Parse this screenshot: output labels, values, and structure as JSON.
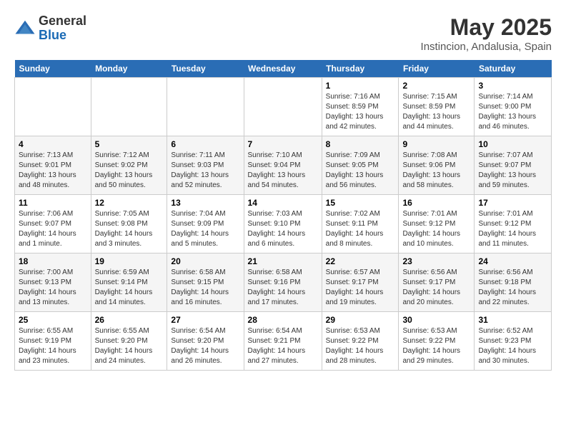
{
  "logo": {
    "general": "General",
    "blue": "Blue"
  },
  "title": "May 2025",
  "location": "Instincion, Andalusia, Spain",
  "days_of_week": [
    "Sunday",
    "Monday",
    "Tuesday",
    "Wednesday",
    "Thursday",
    "Friday",
    "Saturday"
  ],
  "weeks": [
    [
      {
        "day": "",
        "sunrise": "",
        "sunset": "",
        "daylight": ""
      },
      {
        "day": "",
        "sunrise": "",
        "sunset": "",
        "daylight": ""
      },
      {
        "day": "",
        "sunrise": "",
        "sunset": "",
        "daylight": ""
      },
      {
        "day": "",
        "sunrise": "",
        "sunset": "",
        "daylight": ""
      },
      {
        "day": "1",
        "sunrise": "Sunrise: 7:16 AM",
        "sunset": "Sunset: 8:59 PM",
        "daylight": "Daylight: 13 hours and 42 minutes."
      },
      {
        "day": "2",
        "sunrise": "Sunrise: 7:15 AM",
        "sunset": "Sunset: 8:59 PM",
        "daylight": "Daylight: 13 hours and 44 minutes."
      },
      {
        "day": "3",
        "sunrise": "Sunrise: 7:14 AM",
        "sunset": "Sunset: 9:00 PM",
        "daylight": "Daylight: 13 hours and 46 minutes."
      }
    ],
    [
      {
        "day": "4",
        "sunrise": "Sunrise: 7:13 AM",
        "sunset": "Sunset: 9:01 PM",
        "daylight": "Daylight: 13 hours and 48 minutes."
      },
      {
        "day": "5",
        "sunrise": "Sunrise: 7:12 AM",
        "sunset": "Sunset: 9:02 PM",
        "daylight": "Daylight: 13 hours and 50 minutes."
      },
      {
        "day": "6",
        "sunrise": "Sunrise: 7:11 AM",
        "sunset": "Sunset: 9:03 PM",
        "daylight": "Daylight: 13 hours and 52 minutes."
      },
      {
        "day": "7",
        "sunrise": "Sunrise: 7:10 AM",
        "sunset": "Sunset: 9:04 PM",
        "daylight": "Daylight: 13 hours and 54 minutes."
      },
      {
        "day": "8",
        "sunrise": "Sunrise: 7:09 AM",
        "sunset": "Sunset: 9:05 PM",
        "daylight": "Daylight: 13 hours and 56 minutes."
      },
      {
        "day": "9",
        "sunrise": "Sunrise: 7:08 AM",
        "sunset": "Sunset: 9:06 PM",
        "daylight": "Daylight: 13 hours and 58 minutes."
      },
      {
        "day": "10",
        "sunrise": "Sunrise: 7:07 AM",
        "sunset": "Sunset: 9:07 PM",
        "daylight": "Daylight: 13 hours and 59 minutes."
      }
    ],
    [
      {
        "day": "11",
        "sunrise": "Sunrise: 7:06 AM",
        "sunset": "Sunset: 9:07 PM",
        "daylight": "Daylight: 14 hours and 1 minute."
      },
      {
        "day": "12",
        "sunrise": "Sunrise: 7:05 AM",
        "sunset": "Sunset: 9:08 PM",
        "daylight": "Daylight: 14 hours and 3 minutes."
      },
      {
        "day": "13",
        "sunrise": "Sunrise: 7:04 AM",
        "sunset": "Sunset: 9:09 PM",
        "daylight": "Daylight: 14 hours and 5 minutes."
      },
      {
        "day": "14",
        "sunrise": "Sunrise: 7:03 AM",
        "sunset": "Sunset: 9:10 PM",
        "daylight": "Daylight: 14 hours and 6 minutes."
      },
      {
        "day": "15",
        "sunrise": "Sunrise: 7:02 AM",
        "sunset": "Sunset: 9:11 PM",
        "daylight": "Daylight: 14 hours and 8 minutes."
      },
      {
        "day": "16",
        "sunrise": "Sunrise: 7:01 AM",
        "sunset": "Sunset: 9:12 PM",
        "daylight": "Daylight: 14 hours and 10 minutes."
      },
      {
        "day": "17",
        "sunrise": "Sunrise: 7:01 AM",
        "sunset": "Sunset: 9:12 PM",
        "daylight": "Daylight: 14 hours and 11 minutes."
      }
    ],
    [
      {
        "day": "18",
        "sunrise": "Sunrise: 7:00 AM",
        "sunset": "Sunset: 9:13 PM",
        "daylight": "Daylight: 14 hours and 13 minutes."
      },
      {
        "day": "19",
        "sunrise": "Sunrise: 6:59 AM",
        "sunset": "Sunset: 9:14 PM",
        "daylight": "Daylight: 14 hours and 14 minutes."
      },
      {
        "day": "20",
        "sunrise": "Sunrise: 6:58 AM",
        "sunset": "Sunset: 9:15 PM",
        "daylight": "Daylight: 14 hours and 16 minutes."
      },
      {
        "day": "21",
        "sunrise": "Sunrise: 6:58 AM",
        "sunset": "Sunset: 9:16 PM",
        "daylight": "Daylight: 14 hours and 17 minutes."
      },
      {
        "day": "22",
        "sunrise": "Sunrise: 6:57 AM",
        "sunset": "Sunset: 9:17 PM",
        "daylight": "Daylight: 14 hours and 19 minutes."
      },
      {
        "day": "23",
        "sunrise": "Sunrise: 6:56 AM",
        "sunset": "Sunset: 9:17 PM",
        "daylight": "Daylight: 14 hours and 20 minutes."
      },
      {
        "day": "24",
        "sunrise": "Sunrise: 6:56 AM",
        "sunset": "Sunset: 9:18 PM",
        "daylight": "Daylight: 14 hours and 22 minutes."
      }
    ],
    [
      {
        "day": "25",
        "sunrise": "Sunrise: 6:55 AM",
        "sunset": "Sunset: 9:19 PM",
        "daylight": "Daylight: 14 hours and 23 minutes."
      },
      {
        "day": "26",
        "sunrise": "Sunrise: 6:55 AM",
        "sunset": "Sunset: 9:20 PM",
        "daylight": "Daylight: 14 hours and 24 minutes."
      },
      {
        "day": "27",
        "sunrise": "Sunrise: 6:54 AM",
        "sunset": "Sunset: 9:20 PM",
        "daylight": "Daylight: 14 hours and 26 minutes."
      },
      {
        "day": "28",
        "sunrise": "Sunrise: 6:54 AM",
        "sunset": "Sunset: 9:21 PM",
        "daylight": "Daylight: 14 hours and 27 minutes."
      },
      {
        "day": "29",
        "sunrise": "Sunrise: 6:53 AM",
        "sunset": "Sunset: 9:22 PM",
        "daylight": "Daylight: 14 hours and 28 minutes."
      },
      {
        "day": "30",
        "sunrise": "Sunrise: 6:53 AM",
        "sunset": "Sunset: 9:22 PM",
        "daylight": "Daylight: 14 hours and 29 minutes."
      },
      {
        "day": "31",
        "sunrise": "Sunrise: 6:52 AM",
        "sunset": "Sunset: 9:23 PM",
        "daylight": "Daylight: 14 hours and 30 minutes."
      }
    ]
  ]
}
